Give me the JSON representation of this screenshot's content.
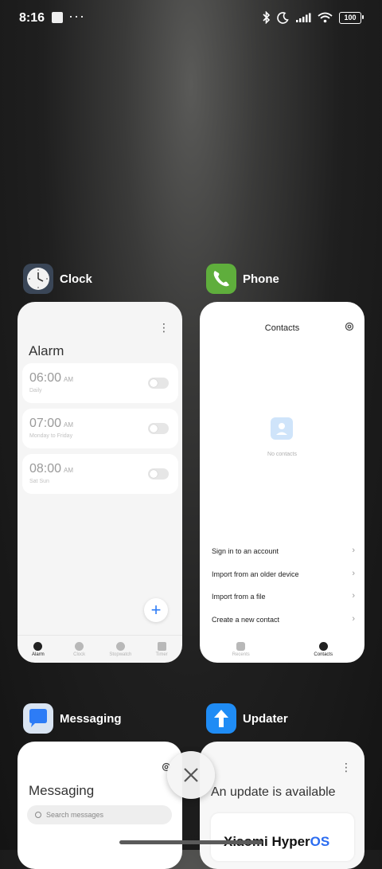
{
  "status": {
    "time": "8:16",
    "battery": "100"
  },
  "apps": [
    {
      "name": "Clock",
      "title": "Alarm",
      "alarms": [
        {
          "time": "06:00",
          "ampm": "AM",
          "sub": "Daily"
        },
        {
          "time": "07:00",
          "ampm": "AM",
          "sub": "Monday to Friday"
        },
        {
          "time": "08:00",
          "ampm": "AM",
          "sub": "Sat Sun"
        }
      ],
      "add": "+",
      "nav": [
        "Alarm",
        "Clock",
        "Stopwatch",
        "Timer"
      ]
    },
    {
      "name": "Phone",
      "title": "Contacts",
      "empty": "No contacts",
      "actions": [
        "Sign in to an account",
        "Import from an older device",
        "Import from a file",
        "Create a new contact"
      ],
      "nav": [
        "Recents",
        "Contacts"
      ]
    },
    {
      "name": "Messaging",
      "title": "Messaging",
      "search_placeholder": "Search messages"
    },
    {
      "name": "Updater",
      "title": "An update is available",
      "logo_left": "Xiaomi Hyper",
      "logo_right": "OS"
    }
  ],
  "colors": {
    "accent": "#2d7cf6",
    "hyperos_blue": "#2b6cf0"
  }
}
